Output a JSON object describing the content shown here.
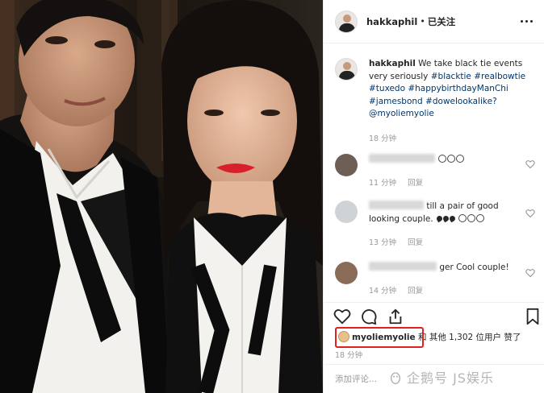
{
  "post": {
    "username": "hakkaphil",
    "separator": "•",
    "follow_status": "已关注",
    "caption": {
      "username": "hakkaphil",
      "text": "We take black tie events very seriously",
      "hashtags": [
        "#blacktie",
        "#realbowtie",
        "#tuxedo",
        "#happybirthdayManChi",
        "#jamesbond",
        "#dowelookalike?"
      ],
      "mention": "@myoliemyolie",
      "time": "18 分钟"
    },
    "comments": [
      {
        "text": "",
        "time": "11 分钟",
        "reply": "回复"
      },
      {
        "text": "till a pair of good looking couple.",
        "time": "13 分钟",
        "reply": "回复"
      },
      {
        "text": "ger Cool couple!",
        "time": "14 分钟",
        "reply": "回复"
      }
    ],
    "likes": {
      "first_user": "myoliemyolie",
      "text": "和 其他 1,302 位用户 赞了",
      "time": "18 分钟"
    },
    "add_comment_placeholder": "添加评论..."
  },
  "watermark": {
    "text": "企鹅号 JS娱乐"
  },
  "icons": {
    "more": "more-dots-icon",
    "like": "heart-icon",
    "comment": "comment-bubble-icon",
    "share": "share-icon",
    "save": "bookmark-icon"
  },
  "colors": {
    "link": "#003569",
    "muted": "#999999",
    "highlight_box": "#e0211d",
    "text": "#262626"
  }
}
